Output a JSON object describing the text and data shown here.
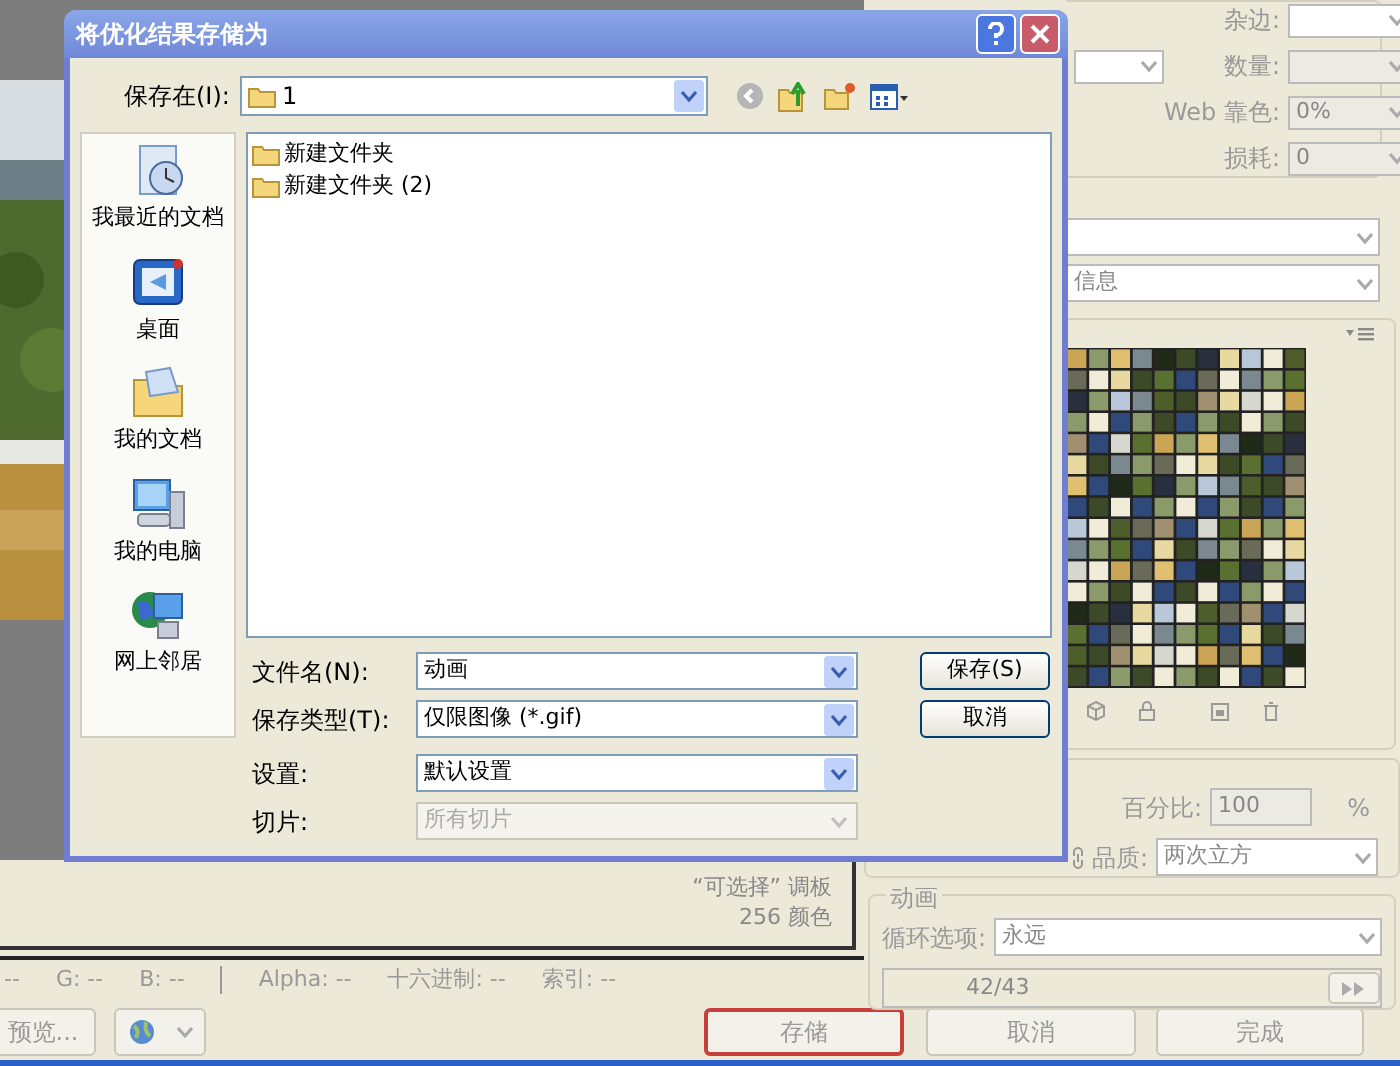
{
  "background_window": {
    "settings": [
      {
        "label": "杂边:",
        "disabled": false,
        "left_dropdown": false
      },
      {
        "label": "数量:",
        "disabled": true,
        "left_dropdown": true
      },
      {
        "label": "Web 靠色:",
        "value": "0%",
        "disabled": true,
        "left_dropdown": false
      },
      {
        "label": "损耗:",
        "value": "0",
        "disabled": true,
        "left_dropdown": false
      }
    ],
    "info_dropdown": "信息",
    "palette_info": [
      "“可选择” 调板",
      "256 颜色"
    ],
    "image_size": {
      "percent_label": "百分比:",
      "percent_value": "100",
      "percent_unit": "%",
      "quality_label": "品质:",
      "quality_value": "两次立方"
    },
    "animation": {
      "title": "动画",
      "loop_label": "循环选项:",
      "loop_value": "永远",
      "frame_counter": "42/43"
    },
    "status_bar": [
      "--",
      "G: --",
      "B: --",
      "Alpha: --",
      "十六进制: --",
      "索引: --"
    ],
    "buttons": [
      {
        "kind": "text",
        "label": "预览...",
        "highlighted": false
      },
      {
        "kind": "browser"
      },
      {
        "kind": "text",
        "label": "存储",
        "highlighted": true
      },
      {
        "kind": "text",
        "label": "取消",
        "highlighted": false
      },
      {
        "kind": "text",
        "label": "完成",
        "highlighted": false
      }
    ]
  },
  "dialog": {
    "title": "将优化结果存储为",
    "save_in_label": "保存在(I):",
    "save_in_value": "1",
    "places": [
      "我最近的文档",
      "桌面",
      "我的文档",
      "我的电脑",
      "网上邻居"
    ],
    "files": [
      "新建文件夹",
      "新建文件夹 (2)"
    ],
    "fields": [
      {
        "label": "文件名(N):",
        "value": "动画",
        "disabled": false
      },
      {
        "label": "保存类型(T):",
        "value": "仅限图像 (*.gif)",
        "disabled": false
      },
      {
        "label": "设置:",
        "value": "默认设置",
        "disabled": false
      },
      {
        "label": "切片:",
        "value": "所有切片",
        "disabled": true
      }
    ],
    "buttons": [
      "保存(S)",
      "取消"
    ]
  }
}
